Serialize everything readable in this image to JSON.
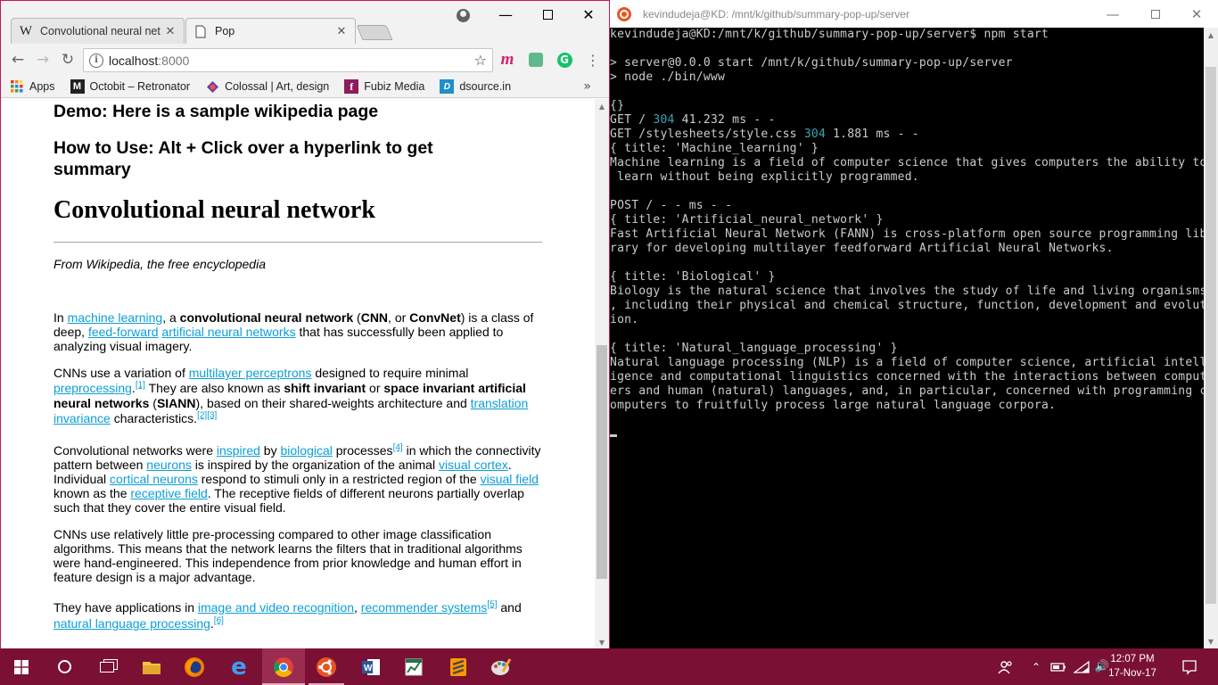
{
  "chrome": {
    "tabs": [
      {
        "title": "Convolutional neural net",
        "favicon": "W"
      },
      {
        "title": "Pop"
      }
    ],
    "url_host": "localhost",
    "url_port": ":8000",
    "bookmarks": [
      {
        "label": "Apps",
        "icon": "apps-grid-icon"
      },
      {
        "label": "Octobit – Retronator",
        "icon": "M"
      },
      {
        "label": "Colossal | Art, design",
        "icon": "colossal-icon"
      },
      {
        "label": "Fubiz Media",
        "icon": "f"
      },
      {
        "label": "dsource.in",
        "icon": "D"
      }
    ],
    "more": "»"
  },
  "page": {
    "demo": "Demo: Here is a sample wikipedia page",
    "howto": "How to Use: Alt + Click over a hyperlink to get summary",
    "title": "Convolutional neural network",
    "from": "From Wikipedia, the free encyclopedia"
  },
  "terminal": {
    "title": "kevindudeja@KD: /mnt/k/github/summary-pop-up/server",
    "lines": [
      {
        "t": "kevindudeja@KD:/mnt/k/github/summary-pop-up/server$ npm start"
      },
      {
        "t": ""
      },
      {
        "t": "> server@0.0.0 start /mnt/k/github/summary-pop-up/server"
      },
      {
        "t": "> node ./bin/www"
      },
      {
        "t": ""
      },
      {
        "t": "{}"
      },
      {
        "pre": "GET / ",
        "num": "304",
        "post": " 41.232 ms - -"
      },
      {
        "pre": "GET /stylesheets/style.css ",
        "num": "304",
        "post": " 1.881 ms - -"
      },
      {
        "t": "{ title: 'Machine_learning' }"
      },
      {
        "t": "Machine learning is a field of computer science that gives computers the ability to"
      },
      {
        "t": " learn without being explicitly programmed."
      },
      {
        "t": ""
      },
      {
        "t": "POST / - - ms - -"
      },
      {
        "t": "{ title: 'Artificial_neural_network' }"
      },
      {
        "t": "Fast Artificial Neural Network (FANN) is cross-platform open source programming lib"
      },
      {
        "t": "rary for developing multilayer feedforward Artificial Neural Networks."
      },
      {
        "t": ""
      },
      {
        "t": "{ title: 'Biological' }"
      },
      {
        "t": "Biology is the natural science that involves the study of life and living organisms"
      },
      {
        "t": ", including their physical and chemical structure, function, development and evolut"
      },
      {
        "t": "ion."
      },
      {
        "t": ""
      },
      {
        "t": "{ title: 'Natural_language_processing' }"
      },
      {
        "t": "Natural language processing (NLP) is a field of computer science, artificial intell"
      },
      {
        "t": "igence and computational linguistics concerned with the interactions between comput"
      },
      {
        "t": "ers and human (natural) languages, and, in particular, concerned with programming c"
      },
      {
        "t": "omputers to fruitfully process large natural language corpora."
      },
      {
        "t": ""
      }
    ]
  },
  "taskbar": {
    "time": "12:07 PM",
    "date": "17-Nov-17",
    "apps": [
      "start-icon",
      "cortana-icon",
      "task-view-icon",
      "file-explorer-icon",
      "firefox-icon",
      "edge-icon",
      "chrome-icon",
      "ubuntu-icon",
      "word-icon",
      "excel-icon",
      "sublime-text-icon",
      "paint-icon"
    ]
  },
  "colors": {
    "link": "#0b9ed8",
    "taskbar": "#7a1033",
    "ubuntu": "#e95420",
    "terminal_number": "#3aa5b5"
  }
}
